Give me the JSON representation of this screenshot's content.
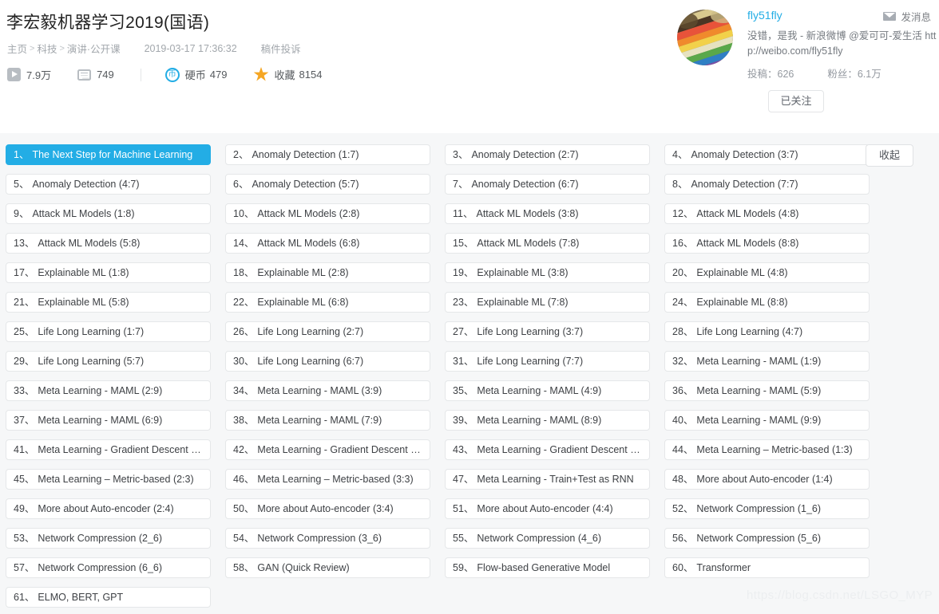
{
  "header": {
    "title": "李宏毅机器学习2019(国语)",
    "breadcrumb": {
      "home": "主页",
      "category": "科技",
      "subcategory": "演讲·公开课",
      "separator": ">"
    },
    "pubdate": "2019-03-17 17:36:32",
    "complaint": "稿件投诉",
    "stats": {
      "views": "7.9万",
      "danmaku": "749",
      "coin_label": "硬币",
      "coin_value": "479",
      "favorite_label": "收藏",
      "favorite_value": "8154"
    }
  },
  "uploader": {
    "name": "fly51fly",
    "message_label": "发消息",
    "signature": "没错，是我 - 新浪微博 @爱可可-爱生活 http://weibo.com/fly51fly",
    "submissions": "投稿：626",
    "fans": "粉丝：6.1万",
    "follow_state": "已关注"
  },
  "list": {
    "collapse_label": "收起",
    "active_index": 0,
    "episodes": [
      {
        "num": "1、",
        "title": "The Next Step for Machine Learning"
      },
      {
        "num": "2、",
        "title": "Anomaly Detection (1:7)"
      },
      {
        "num": "3、",
        "title": "Anomaly Detection (2:7)"
      },
      {
        "num": "4、",
        "title": "Anomaly Detection (3:7)"
      },
      {
        "num": "5、",
        "title": "Anomaly Detection (4:7)"
      },
      {
        "num": "6、",
        "title": "Anomaly Detection (5:7)"
      },
      {
        "num": "7、",
        "title": "Anomaly Detection (6:7)"
      },
      {
        "num": "8、",
        "title": "Anomaly Detection (7:7)"
      },
      {
        "num": "9、",
        "title": "Attack ML Models (1:8)"
      },
      {
        "num": "10、",
        "title": "Attack ML Models (2:8)"
      },
      {
        "num": "11、",
        "title": "Attack ML Models (3:8)"
      },
      {
        "num": "12、",
        "title": "Attack ML Models (4:8)"
      },
      {
        "num": "13、",
        "title": "Attack ML Models (5:8)"
      },
      {
        "num": "14、",
        "title": "Attack ML Models (6:8)"
      },
      {
        "num": "15、",
        "title": "Attack ML Models (7:8)"
      },
      {
        "num": "16、",
        "title": "Attack ML Models (8:8)"
      },
      {
        "num": "17、",
        "title": "Explainable ML (1:8)"
      },
      {
        "num": "18、",
        "title": "Explainable ML (2:8)"
      },
      {
        "num": "19、",
        "title": "Explainable ML (3:8)"
      },
      {
        "num": "20、",
        "title": "Explainable ML (4:8)"
      },
      {
        "num": "21、",
        "title": "Explainable ML (5:8)"
      },
      {
        "num": "22、",
        "title": "Explainable ML (6:8)"
      },
      {
        "num": "23、",
        "title": "Explainable ML (7:8)"
      },
      {
        "num": "24、",
        "title": "Explainable ML (8:8)"
      },
      {
        "num": "25、",
        "title": "Life Long Learning (1:7)"
      },
      {
        "num": "26、",
        "title": "Life Long Learning (2:7)"
      },
      {
        "num": "27、",
        "title": "Life Long Learning (3:7)"
      },
      {
        "num": "28、",
        "title": "Life Long Learning (4:7)"
      },
      {
        "num": "29、",
        "title": "Life Long Learning (5:7)"
      },
      {
        "num": "30、",
        "title": "Life Long Learning (6:7)"
      },
      {
        "num": "31、",
        "title": "Life Long Learning (7:7)"
      },
      {
        "num": "32、",
        "title": "Meta Learning - MAML (1:9)"
      },
      {
        "num": "33、",
        "title": "Meta Learning - MAML (2:9)"
      },
      {
        "num": "34、",
        "title": "Meta Learning - MAML (3:9)"
      },
      {
        "num": "35、",
        "title": "Meta Learning - MAML (4:9)"
      },
      {
        "num": "36、",
        "title": "Meta Learning - MAML (5:9)"
      },
      {
        "num": "37、",
        "title": "Meta Learning - MAML (6:9)"
      },
      {
        "num": "38、",
        "title": "Meta Learning - MAML (7:9)"
      },
      {
        "num": "39、",
        "title": "Meta Learning - MAML (8:9)"
      },
      {
        "num": "40、",
        "title": "Meta Learning - MAML (9:9)"
      },
      {
        "num": "41、",
        "title": "Meta Learning - Gradient Descent as ..."
      },
      {
        "num": "42、",
        "title": "Meta Learning - Gradient Descent as ..."
      },
      {
        "num": "43、",
        "title": "Meta Learning - Gradient Descent as ..."
      },
      {
        "num": "44、",
        "title": "Meta Learning – Metric-based (1:3)"
      },
      {
        "num": "45、",
        "title": "Meta Learning – Metric-based (2:3)"
      },
      {
        "num": "46、",
        "title": "Meta Learning – Metric-based (3:3)"
      },
      {
        "num": "47、",
        "title": "Meta Learning - Train+Test as RNN"
      },
      {
        "num": "48、",
        "title": "More about Auto-encoder (1:4)"
      },
      {
        "num": "49、",
        "title": "More about Auto-encoder (2:4)"
      },
      {
        "num": "50、",
        "title": "More about Auto-encoder (3:4)"
      },
      {
        "num": "51、",
        "title": "More about Auto-encoder (4:4)"
      },
      {
        "num": "52、",
        "title": "Network Compression (1_6)"
      },
      {
        "num": "53、",
        "title": "Network Compression (2_6)"
      },
      {
        "num": "54、",
        "title": "Network Compression (3_6)"
      },
      {
        "num": "55、",
        "title": "Network Compression (4_6)"
      },
      {
        "num": "56、",
        "title": "Network Compression (5_6)"
      },
      {
        "num": "57、",
        "title": "Network Compression (6_6)"
      },
      {
        "num": "58、",
        "title": "GAN (Quick Review)"
      },
      {
        "num": "59、",
        "title": "Flow-based Generative Model"
      },
      {
        "num": "60、",
        "title": "Transformer"
      },
      {
        "num": "61、",
        "title": "ELMO, BERT, GPT"
      }
    ]
  },
  "watermark": "https://blog.csdn.net/LSGO_MYP",
  "colors": {
    "accent": "#23ade5",
    "coin": "#23ade5",
    "star": "#f5a623",
    "panel_bg": "#f6f7f8"
  }
}
